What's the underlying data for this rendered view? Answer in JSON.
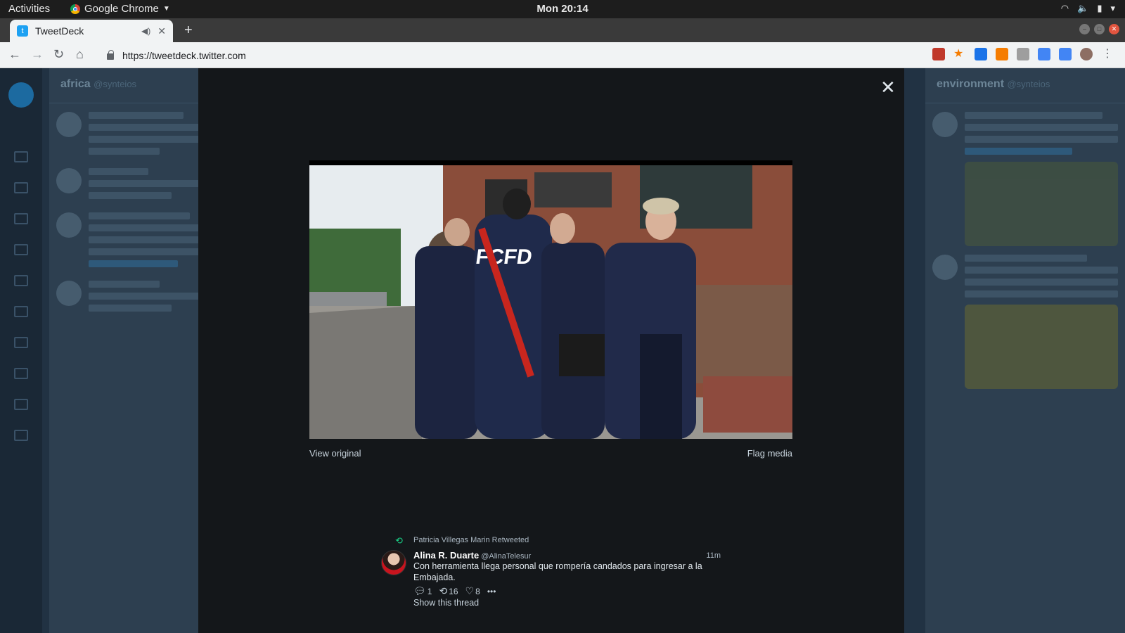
{
  "system_bar": {
    "activities": "Activities",
    "app_name": "Google Chrome",
    "clock": "Mon 20:14"
  },
  "browser": {
    "tab_title": "TweetDeck",
    "url": "https://tweetdeck.twitter.com",
    "new_tab": "+"
  },
  "background_columns": [
    {
      "title": "africa",
      "handle": "@synteios"
    },
    {
      "title": "environment",
      "handle": "@synteios"
    }
  ],
  "modal": {
    "close_glyph": "✕",
    "view_original": "View original",
    "flag_media": "Flag media",
    "video_text": "FCFD"
  },
  "tweet": {
    "retweeted_by": "Patricia Villegas Marin Retweeted",
    "author_name": "Alina R. Duarte",
    "author_handle": "@AlinaTelesur",
    "time": "11m",
    "text": "Con herramienta llega personal que rompería candados para ingresar a la Embajada.",
    "replies": "1",
    "retweets": "16",
    "likes": "8",
    "more": "•••",
    "show_thread": "Show this thread"
  },
  "colors": {
    "modal_bg": "#14171a",
    "retweet_green": "#19cf86",
    "twitter_blue": "#1da1f2"
  }
}
